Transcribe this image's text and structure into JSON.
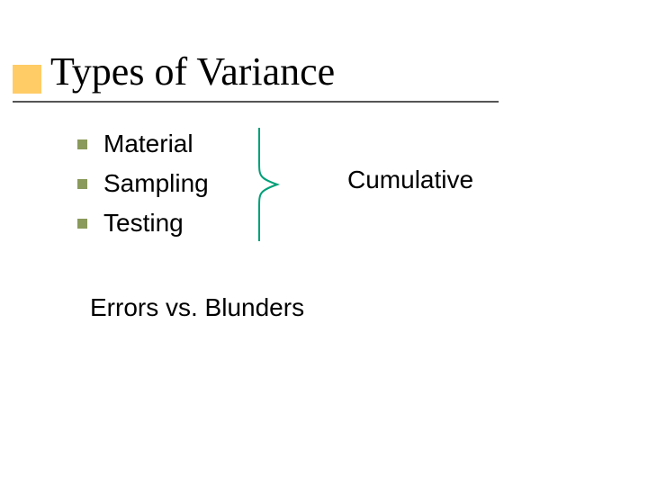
{
  "title": "Types of Variance",
  "bullets": {
    "items": [
      {
        "label": "Material"
      },
      {
        "label": "Sampling"
      },
      {
        "label": "Testing"
      }
    ]
  },
  "brace_label": "Cumulative",
  "subheading": "Errors vs. Blunders",
  "colors": {
    "accent": "#ffcc66",
    "bullet": "#8a9a5b",
    "brace_stroke": "#00a078"
  }
}
